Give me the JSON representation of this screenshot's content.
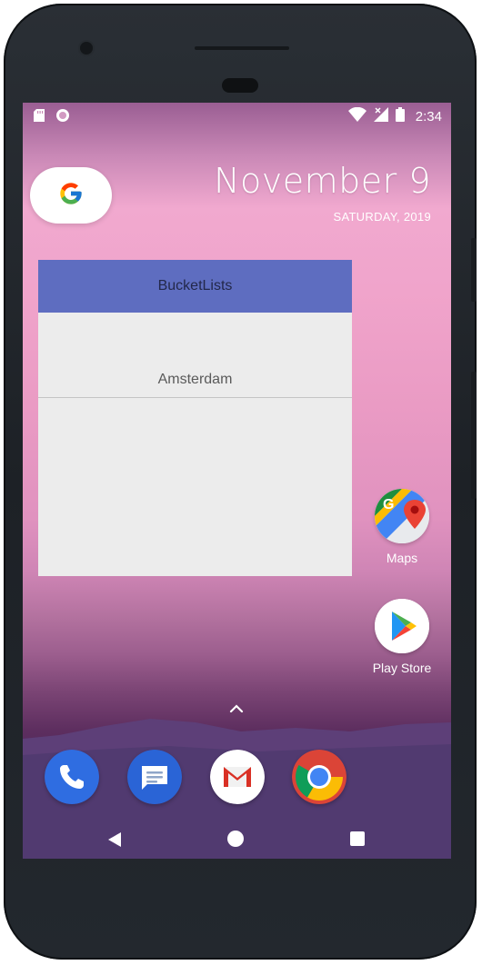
{
  "status_bar": {
    "time": "2:34",
    "icons": [
      "sd-card-icon",
      "circle-notification-icon",
      "wifi-icon",
      "signal-icon",
      "battery-icon"
    ]
  },
  "search_widget": {
    "icon": "google-g-icon"
  },
  "clock_widget": {
    "date": "November 9",
    "day": "SATURDAY, 2019"
  },
  "bucket_widget": {
    "title": "BucketLists",
    "items": [
      "Amsterdam"
    ],
    "header_color": "#5e6dc0"
  },
  "apps": [
    {
      "label": "Maps",
      "icon": "maps-icon"
    },
    {
      "label": "Play Store",
      "icon": "play-store-icon"
    }
  ],
  "dock": [
    {
      "icon": "phone-icon"
    },
    {
      "icon": "messages-icon"
    },
    {
      "icon": "gmail-icon"
    },
    {
      "icon": "chrome-icon"
    }
  ],
  "navigation": {
    "back": "back-icon",
    "home": "home-icon",
    "recents": "recents-icon"
  }
}
